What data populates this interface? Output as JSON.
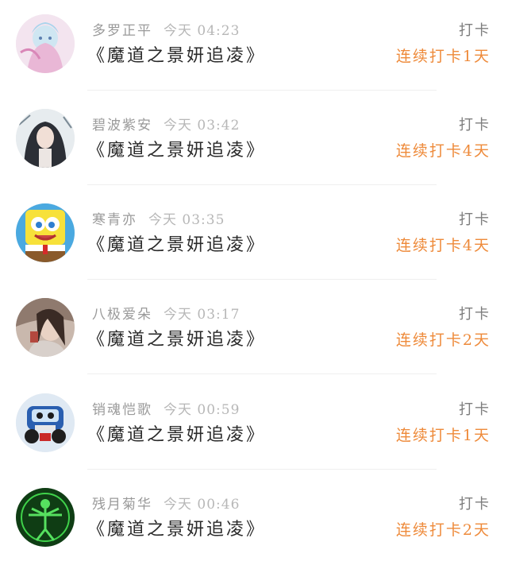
{
  "colors": {
    "name": "#9a9a9a",
    "time": "#b7b7b7",
    "book": "#2a2a2a",
    "checkin": "#7d7d7d",
    "streak": "#ee8a3a"
  },
  "rows": [
    {
      "name": "多罗正平",
      "time": "今天 04:23",
      "book": "《魔道之景妍追凌》",
      "checkin": "打卡",
      "streak": "连续打卡1天",
      "avatar_icon": "anime-girl-avatar"
    },
    {
      "name": "碧波紫安",
      "time": "今天 03:42",
      "book": "《魔道之景妍追凌》",
      "checkin": "打卡",
      "streak": "连续打卡4天",
      "avatar_icon": "dark-hair-girl-avatar"
    },
    {
      "name": "寒青亦",
      "time": "今天 03:35",
      "book": "《魔道之景妍追凌》",
      "checkin": "打卡",
      "streak": "连续打卡4天",
      "avatar_icon": "spongebob-avatar"
    },
    {
      "name": "八极爱朵",
      "time": "今天 03:17",
      "book": "《魔道之景妍追凌》",
      "checkin": "打卡",
      "streak": "连续打卡2天",
      "avatar_icon": "girl-photo-avatar"
    },
    {
      "name": "销魂恺歌",
      "time": "今天 00:59",
      "book": "《魔道之景妍追凌》",
      "checkin": "打卡",
      "streak": "连续打卡1天",
      "avatar_icon": "cartoon-car-avatar"
    },
    {
      "name": "残月菊华",
      "time": "今天 00:46",
      "book": "《魔道之景妍追凌》",
      "checkin": "打卡",
      "streak": "连续打卡2天",
      "avatar_icon": "green-glow-figure-avatar"
    }
  ]
}
